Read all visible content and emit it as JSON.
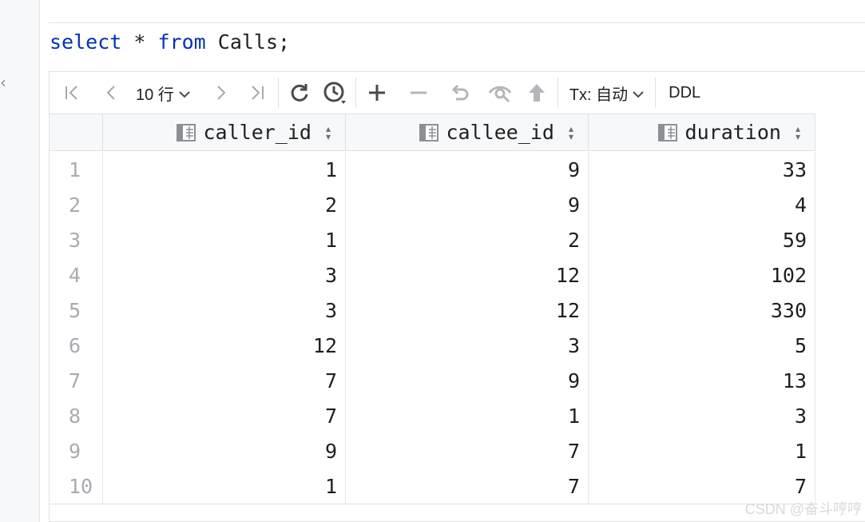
{
  "editor": {
    "sql": {
      "kw_select": "select",
      "star": "*",
      "kw_from": "from",
      "table": "Calls;"
    }
  },
  "toolbar": {
    "page_size_label": "10 行",
    "tx_label": "Tx: 自动",
    "ddl_label": "DDL"
  },
  "table": {
    "columns": [
      "caller_id",
      "callee_id",
      "duration"
    ],
    "rows": [
      [
        "1",
        "1",
        "9",
        "33"
      ],
      [
        "2",
        "2",
        "9",
        "4"
      ],
      [
        "3",
        "1",
        "2",
        "59"
      ],
      [
        "4",
        "3",
        "12",
        "102"
      ],
      [
        "5",
        "3",
        "12",
        "330"
      ],
      [
        "6",
        "12",
        "3",
        "5"
      ],
      [
        "7",
        "7",
        "9",
        "13"
      ],
      [
        "8",
        "7",
        "1",
        "3"
      ],
      [
        "9",
        "9",
        "7",
        "1"
      ],
      [
        "10",
        "1",
        "7",
        "7"
      ]
    ]
  },
  "watermark": "CSDN @奋斗哼哼"
}
